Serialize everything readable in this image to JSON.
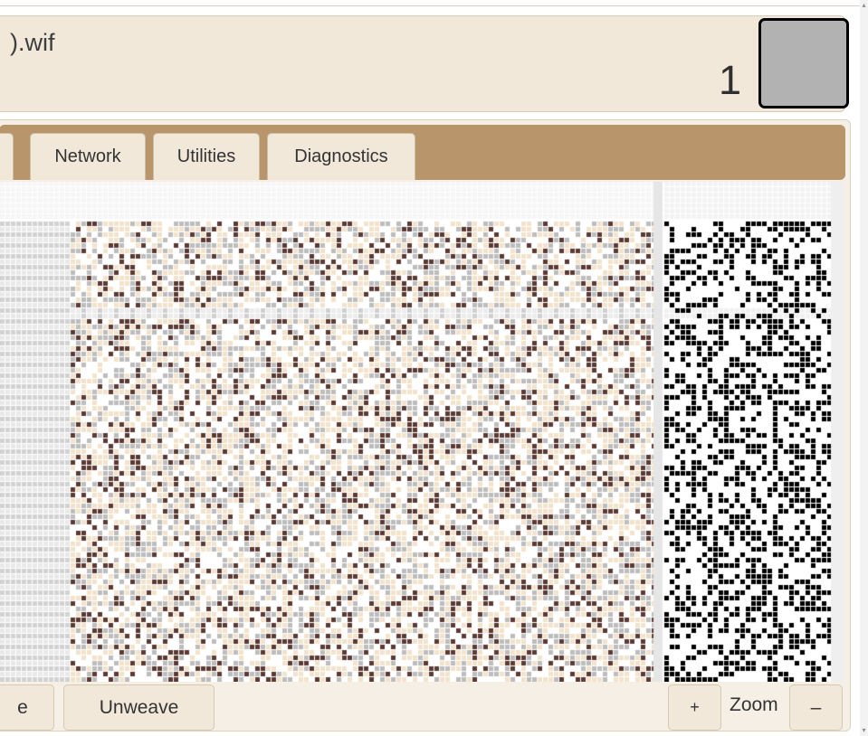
{
  "header": {
    "filename": ").wif",
    "count": "1",
    "swatch_color": "#b2b2b2"
  },
  "tabs": [
    {
      "label": "Network"
    },
    {
      "label": "Utilities"
    },
    {
      "label": "Diagnostics"
    }
  ],
  "draft": {
    "colors": {
      "warp_dark": "#5b3a33",
      "weft_light": "#f3e3cb",
      "gray": "#bdbdbd",
      "white": "#ffffff",
      "grid": "#dcdcdc",
      "black": "#000000"
    }
  },
  "bottom": {
    "partial_button_label": "e",
    "unweave_label": "Unweave",
    "zoom_in_label": "+",
    "zoom_label": "Zoom",
    "zoom_out_label": "–"
  },
  "scrollbar": {
    "up_glyph": "▴",
    "down_glyph": "▾"
  }
}
